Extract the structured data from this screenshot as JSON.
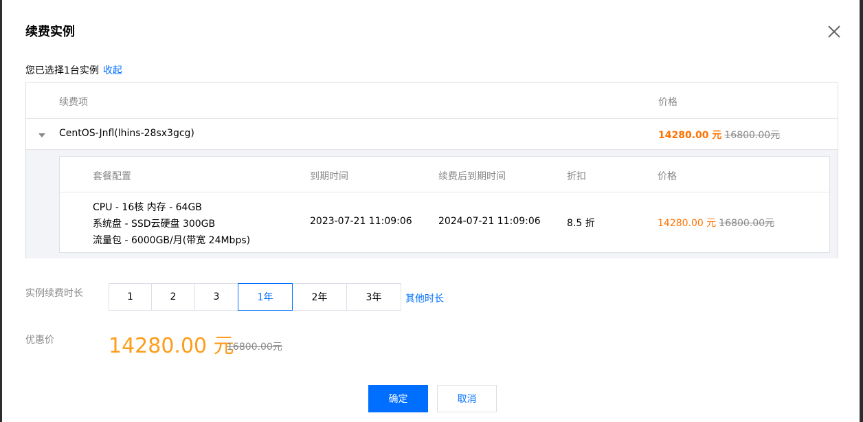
{
  "dialog": {
    "title": "续费实例",
    "close_icon": "close-icon"
  },
  "selection": {
    "text": "您已选择1台实例",
    "collapse_link": "收起"
  },
  "outer_table": {
    "columns": [
      "续费项",
      "价格"
    ],
    "row": {
      "instance_name": "CentOS-Jnfl(lhins-28sx3gcg)",
      "price": "14280.00 元",
      "original_price": "16800.00元"
    }
  },
  "inner_table": {
    "columns": [
      "套餐配置",
      "到期时间",
      "续费后到期时间",
      "折扣",
      "价格"
    ],
    "row": {
      "spec_lines": [
        "CPU - 16核 内存 - 64GB",
        "系统盘 - SSD云硬盘 300GB",
        "流量包 - 6000GB/月(带宽 24Mbps)"
      ],
      "expiry": "2023-07-21 11:09:06",
      "new_expiry": "2024-07-21 11:09:06",
      "discount": "8.5 折",
      "price": "14280.00 元",
      "original_price": "16800.00元"
    }
  },
  "duration": {
    "label": "实例续费时长",
    "options": [
      "1",
      "2",
      "3",
      "1年",
      "2年",
      "3年"
    ],
    "selected": "1年",
    "other_link": "其他时长"
  },
  "pricing": {
    "label": "优惠价",
    "price": "14280.00 元",
    "original_price": "16800.00元"
  },
  "buttons": {
    "confirm": "确定",
    "cancel": "取消"
  },
  "colors": {
    "primary": "#006eff",
    "price_orange": "#ff7200",
    "big_price_orange": "#ff9c19"
  }
}
